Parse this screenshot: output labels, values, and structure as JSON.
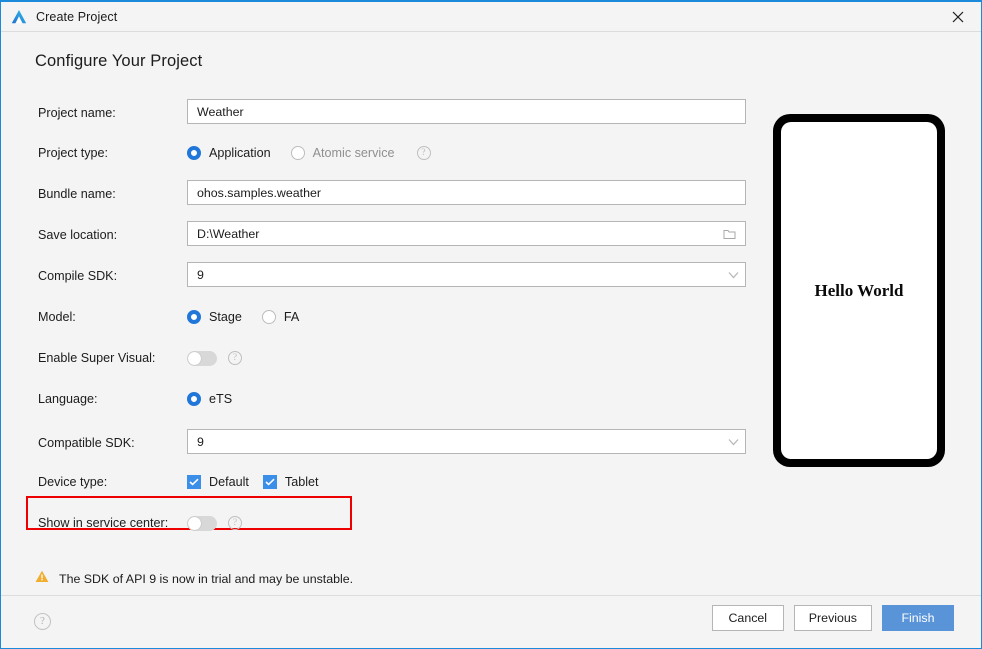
{
  "window": {
    "title": "Create Project",
    "app_icon": "deveco-logo-icon",
    "close_icon": "close-icon",
    "accent_color": "#1c8adb"
  },
  "page": {
    "heading": "Configure Your Project"
  },
  "form": {
    "project_name": {
      "label": "Project name:",
      "value": "Weather",
      "placeholder": "Project name"
    },
    "project_type": {
      "label": "Project type:",
      "options": [
        {
          "label": "Application",
          "selected": true,
          "disabled": false
        },
        {
          "label": "Atomic service",
          "selected": false,
          "disabled": true
        }
      ],
      "help": "?"
    },
    "bundle_name": {
      "label": "Bundle name:",
      "value": "ohos.samples.weather",
      "placeholder": "Bundle name"
    },
    "save_location": {
      "label": "Save location:",
      "value": "D:\\Weather",
      "placeholder": "Save location",
      "trailing_icon": "folder-browse-icon"
    },
    "compile_sdk": {
      "label": "Compile SDK:",
      "value": "9",
      "dropdown_icon": "chevron-down-icon"
    },
    "model": {
      "label": "Model:",
      "options": [
        {
          "label": "Stage",
          "selected": true
        },
        {
          "label": "FA",
          "selected": false
        }
      ]
    },
    "enable_super_visual": {
      "label": "Enable Super Visual:",
      "value": "off",
      "help": "?"
    },
    "language": {
      "label": "Language:",
      "options": [
        {
          "label": "eTS",
          "selected": true
        }
      ]
    },
    "compatible_sdk": {
      "label": "Compatible SDK:",
      "value": "9",
      "dropdown_icon": "chevron-down-icon"
    },
    "device_type": {
      "label": "Device type:",
      "highlighted": true,
      "highlight_color": "#ee0000",
      "options": [
        {
          "label": "Default",
          "checked": true
        },
        {
          "label": "Tablet",
          "checked": true
        }
      ]
    },
    "show_in_service_center": {
      "label": "Show in service center:",
      "value": "off",
      "help": "?"
    }
  },
  "warning": {
    "icon": "warning-triangle-icon",
    "text": "The SDK of API 9 is now in trial and may be unstable.",
    "color": "#f0ad2e"
  },
  "preview": {
    "device": "phone-frame",
    "screen_text": "Hello World"
  },
  "footer": {
    "help_icon": "?",
    "buttons": [
      {
        "label": "Cancel",
        "primary": false
      },
      {
        "label": "Previous",
        "primary": false
      },
      {
        "label": "Finish",
        "primary": true
      }
    ],
    "primary_color": "#5a94d8"
  }
}
